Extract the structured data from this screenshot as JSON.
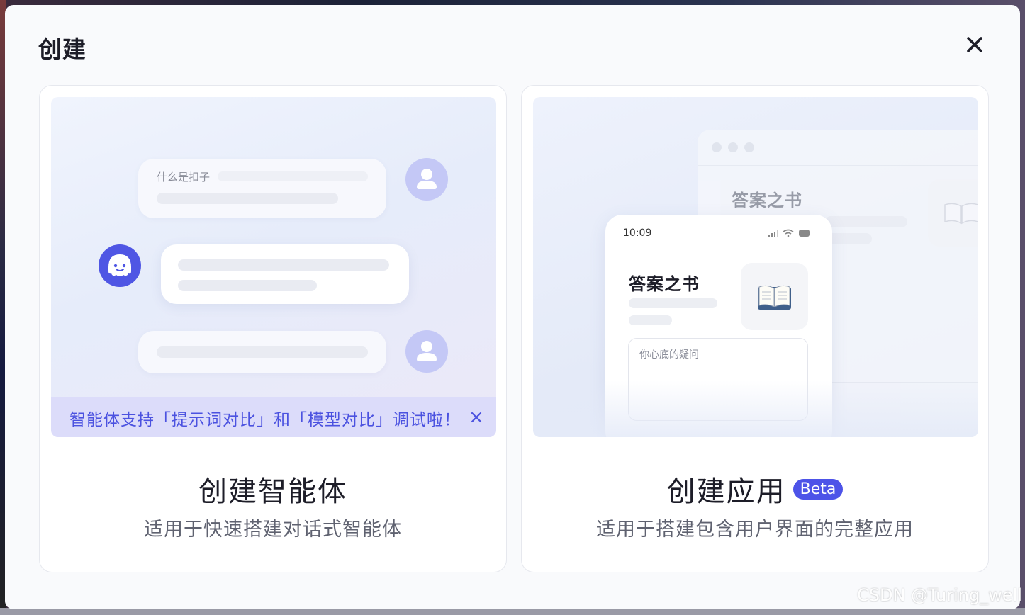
{
  "dialog": {
    "title": "创建",
    "close_icon": "close-icon"
  },
  "cards": {
    "agent": {
      "title": "创建智能体",
      "description": "适用于快速搭建对话式智能体",
      "preview": {
        "user_question": "什么是扣子",
        "tip": "智能体支持「提示词对比」和「模型对比」调试啦！",
        "icons": [
          "user-avatar-icon",
          "bot-avatar-icon",
          "close-icon"
        ]
      }
    },
    "app": {
      "title": "创建应用",
      "badge": "Beta",
      "description": "适用于搭建包含用户界面的完整应用",
      "preview": {
        "desktop_app_title": "答案之书",
        "phone_time": "10:09",
        "phone_app_title": "答案之书",
        "input_placeholder": "你心底的疑问",
        "icons": [
          "open-book-icon",
          "signal-icon",
          "wifi-icon",
          "battery-icon"
        ]
      }
    }
  },
  "watermark": "CSDN @Turing_well",
  "colors": {
    "accent": "#4d53e8",
    "tip_background": "#dcdcfa",
    "avatar": "#c4c8f6",
    "bot": "#4f56e4"
  }
}
